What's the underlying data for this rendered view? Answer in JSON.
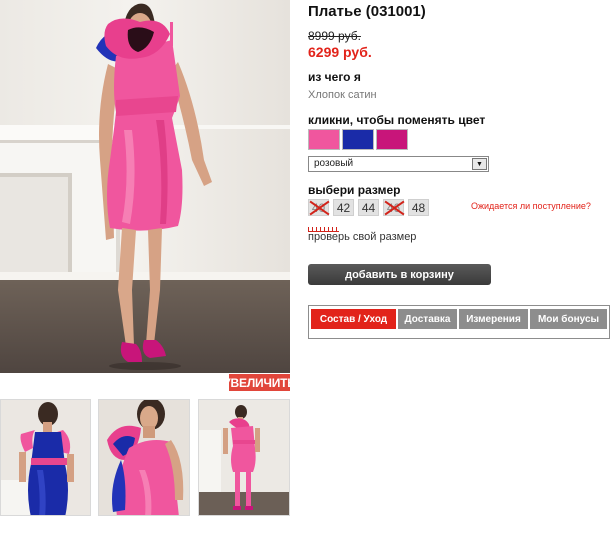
{
  "product": {
    "title": "Платье (031001)",
    "old_price": "8999 руб.",
    "new_price": "6299 руб."
  },
  "gallery": {
    "zoom_label": "УВЕЛИЧИТЬ"
  },
  "material": {
    "label": "из чего я",
    "value": "Хлопок сатин"
  },
  "colors": {
    "label": "кликни, чтобы поменять цвет",
    "swatches": [
      {
        "name": "pink",
        "hex": "#f0569e"
      },
      {
        "name": "blue",
        "hex": "#1a2ba8"
      },
      {
        "name": "magenta",
        "hex": "#c8157a"
      }
    ],
    "selected": "розовый"
  },
  "sizes": {
    "label": "выбери размер",
    "items": [
      {
        "value": "40",
        "available": false
      },
      {
        "value": "42",
        "available": true
      },
      {
        "value": "44",
        "available": true
      },
      {
        "value": "46",
        "available": false
      },
      {
        "value": "48",
        "available": true
      }
    ],
    "notify_label": "Ожидается ли поступление?",
    "size_check_label": "проверь свой размер"
  },
  "cart": {
    "button_label": "добавить в корзину"
  },
  "tabs": [
    {
      "label": "Состав / Уход",
      "active": true
    },
    {
      "label": "Доставка",
      "active": false
    },
    {
      "label": "Измерения",
      "active": false
    },
    {
      "label": "Мои бонусы",
      "active": false
    }
  ],
  "accent_color": "#e2231a",
  "dress_color": "#f0569e"
}
